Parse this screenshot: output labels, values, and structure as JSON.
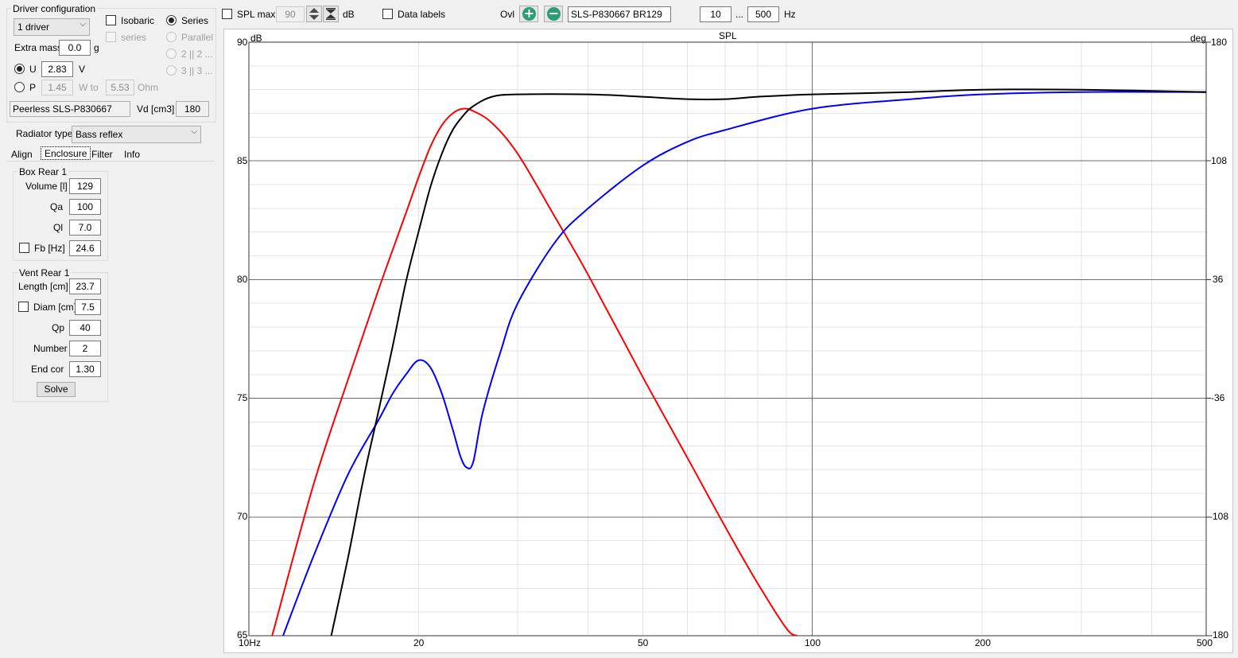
{
  "left_panel": {
    "driver_configuration": {
      "title": "Driver configuration",
      "drivers_select": "1 driver",
      "isobaric_label": "Isobaric",
      "series_sub_label": "series",
      "series_label": "Series",
      "parallel_label": "Parallel",
      "option_2_label": "2 || 2 ...",
      "option_3_label": "3 || 3 ...",
      "extra_mass_label": "Extra mass",
      "extra_mass_value": "0.0",
      "extra_mass_unit": "g",
      "u_label": "U",
      "u_value": "2.83",
      "u_unit": "V",
      "p_label": "P",
      "p_value": "1.45",
      "w_to_label": "W to",
      "ohm_value": "5.53",
      "ohm_unit": "Ohm",
      "driver_name": "Peerless SLS-P830667",
      "vd_label": "Vd [cm3]",
      "vd_value": "180"
    },
    "radiator_type_label": "Radiator type",
    "radiator_type_value": "Bass reflex",
    "tabs": [
      "Align",
      "Enclosure",
      "Filter",
      "Info"
    ],
    "box": {
      "title": "Box Rear 1",
      "volume_label": "Volume [l]",
      "volume": "129",
      "qa_label": "Qa",
      "qa": "100",
      "ql_label": "Ql",
      "ql": "7.0",
      "fb_label": "Fb [Hz]",
      "fb": "24.6"
    },
    "vent": {
      "title": "Vent Rear 1",
      "length_label": "Length [cm]",
      "length": "23.7",
      "diam_label": "Diam [cm]",
      "diam": "7.5",
      "qp_label": "Qp",
      "qp": "40",
      "number_label": "Number",
      "number": "2",
      "endcorr_label": "End corr",
      "endcorr": "1.30",
      "solve_label": "Solve"
    }
  },
  "toolbar": {
    "spl_max_label": "SPL max",
    "spl_max_value": "90",
    "db_label": "dB",
    "data_labels_label": "Data labels",
    "ovl_label": "Ovl",
    "plus_icon_glyph": "+",
    "minus_icon_glyph": "−",
    "overlay_name": "SLS-P830667 BR129",
    "freq_from": "10",
    "range_sep": "...",
    "freq_to": "500",
    "hz_label": "Hz"
  },
  "chart_data": {
    "type": "line",
    "title": "SPL",
    "ylabel": "dB",
    "y2label": "deg",
    "x_scale": "log",
    "xlim": [
      10,
      500
    ],
    "ylim": [
      65,
      90
    ],
    "y2lim": [
      -180,
      180
    ],
    "x_tick_labels": [
      "10Hz",
      "20",
      "50",
      "100",
      "200",
      "500"
    ],
    "x_tick_values": [
      10,
      20,
      50,
      100,
      200,
      500
    ],
    "y_ticks": [
      90,
      85,
      80,
      75,
      70,
      65
    ],
    "y2_ticks": [
      180,
      108,
      36,
      -36,
      -108,
      -180
    ],
    "grid": true,
    "series": [
      {
        "color": "#ff0000",
        "x": [
          11,
          13,
          15,
          17,
          19,
          20,
          21,
          22,
          23,
          24,
          25,
          27,
          30,
          35,
          40,
          50,
          60,
          70,
          80,
          90,
          94
        ],
        "y": [
          65.0,
          71.3,
          75.8,
          79.6,
          82.8,
          84.3,
          85.6,
          86.5,
          87.0,
          87.2,
          87.1,
          86.6,
          85.3,
          82.6,
          80.2,
          75.9,
          72.5,
          69.6,
          67.2,
          65.3,
          65.0
        ]
      },
      {
        "color": "#0000ff",
        "x": [
          11.5,
          13,
          15,
          17,
          18,
          19,
          20,
          21,
          22,
          23,
          23.7,
          24.3,
          25,
          26,
          28,
          30,
          35,
          40,
          50,
          60,
          70,
          100,
          150,
          200,
          300,
          500
        ],
        "y": [
          65.0,
          68.3,
          71.8,
          74.1,
          75.2,
          76.0,
          76.6,
          76.3,
          75.2,
          73.7,
          72.6,
          72.1,
          72.3,
          74.4,
          77.0,
          79.0,
          81.6,
          83.0,
          84.8,
          85.8,
          86.3,
          87.2,
          87.6,
          87.8,
          87.9,
          87.9
        ]
      },
      {
        "color": "#000000",
        "x": [
          14,
          15,
          16,
          17,
          18,
          19,
          20,
          21,
          22,
          23,
          24,
          25,
          27,
          30,
          40,
          50,
          60,
          70,
          80,
          100,
          150,
          200,
          300,
          500
        ],
        "y": [
          65.0,
          68.3,
          71.7,
          74.5,
          77.2,
          79.9,
          82.0,
          83.9,
          85.3,
          86.3,
          86.9,
          87.3,
          87.7,
          87.8,
          87.8,
          87.7,
          87.6,
          87.6,
          87.7,
          87.8,
          87.9,
          88.0,
          88.0,
          87.9
        ]
      }
    ]
  }
}
